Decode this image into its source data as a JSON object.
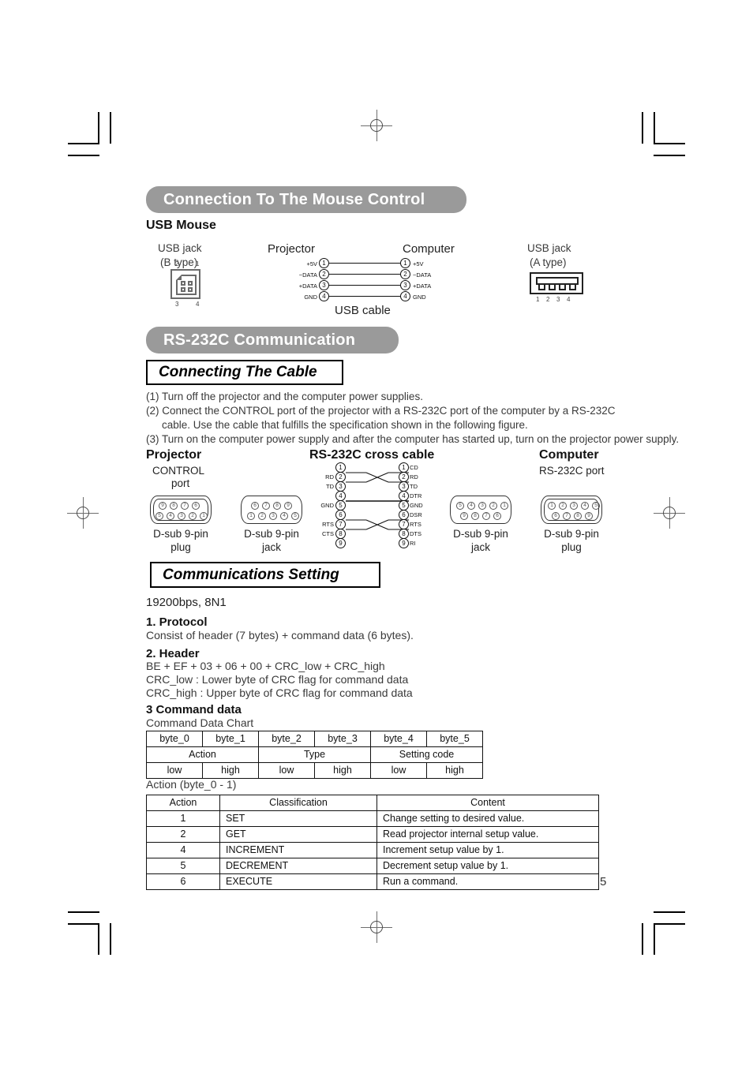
{
  "page": {
    "number": "5"
  },
  "sections": {
    "mouse_banner": "Connection To The Mouse Control",
    "rs232_banner": "RS-232C Communication",
    "connecting_cable_heading": "Connecting The Cable",
    "communications_setting_heading": "Communications Setting"
  },
  "usb": {
    "subheading": "USB Mouse",
    "jack_b": {
      "line1": "USB jack",
      "line2": "(B type)",
      "pins": [
        "2",
        "1",
        "3",
        "4"
      ]
    },
    "jack_a": {
      "line1": "USB jack",
      "line2": "(A type)",
      "pins": [
        "1",
        "2",
        "3",
        "4"
      ]
    },
    "left_device": "Projector",
    "right_device": "Computer",
    "cable_label": "USB cable",
    "pins": [
      {
        "num": "1",
        "left_signal": "+5V",
        "right_signal": "+5V"
      },
      {
        "num": "2",
        "left_signal": "−DATA",
        "right_signal": "−DATA"
      },
      {
        "num": "3",
        "left_signal": "+DATA",
        "right_signal": "+DATA"
      },
      {
        "num": "4",
        "left_signal": "GND",
        "right_signal": "GND"
      }
    ]
  },
  "connecting_steps": [
    "(1) Turn off the projector and the computer power supplies.",
    "(2) Connect the CONTROL port of the projector with a RS-232C port of the computer by a RS-232C",
    "cable. Use the cable that fulfills the specification shown in the following figure.",
    "(3) Turn on the computer power supply and after the computer has started up, turn on the projector power supply."
  ],
  "cable_diagram": {
    "left_title": "Projector",
    "left_sub_line1": "CONTROL",
    "left_sub_line2": "port",
    "center_title": "RS-232C cross cable",
    "right_title": "Computer",
    "right_sub": "RS-232C port",
    "connectors": [
      {
        "label_line1": "D-sub 9-pin",
        "label_line2": "plug",
        "type": "plug",
        "top_pins": [
          "9",
          "8",
          "7",
          "6"
        ],
        "bottom_pins": [
          "5",
          "4",
          "3",
          "2",
          "1"
        ]
      },
      {
        "label_line1": "D-sub 9-pin",
        "label_line2": "jack",
        "type": "jack",
        "top_pins": [
          "6",
          "7",
          "8",
          "9"
        ],
        "bottom_pins": [
          "1",
          "2",
          "3",
          "4",
          "5"
        ]
      },
      {
        "label_line1": "D-sub 9-pin",
        "label_line2": "jack",
        "type": "jack",
        "top_pins": [
          "5",
          "4",
          "3",
          "2",
          "1"
        ],
        "bottom_pins": [
          "9",
          "8",
          "7",
          "6"
        ]
      },
      {
        "label_line1": "D-sub 9-pin",
        "label_line2": "plug",
        "type": "plug",
        "top_pins": [
          "1",
          "2",
          "3",
          "4",
          "5"
        ],
        "bottom_pins": [
          "6",
          "7",
          "8",
          "9"
        ]
      }
    ],
    "pins": [
      {
        "num": "1",
        "left_signal": "",
        "right_signal": "CD"
      },
      {
        "num": "2",
        "left_signal": "RD",
        "right_signal": "RD"
      },
      {
        "num": "3",
        "left_signal": "TD",
        "right_signal": "TD"
      },
      {
        "num": "4",
        "left_signal": "",
        "right_signal": "DTR"
      },
      {
        "num": "5",
        "left_signal": "GND",
        "right_signal": "GND"
      },
      {
        "num": "6",
        "left_signal": "",
        "right_signal": "DSR"
      },
      {
        "num": "7",
        "left_signal": "RTS",
        "right_signal": "RTS"
      },
      {
        "num": "8",
        "left_signal": "CTS",
        "right_signal": "DTS"
      },
      {
        "num": "9",
        "left_signal": "",
        "right_signal": "RI"
      }
    ]
  },
  "comm": {
    "baud_line": "19200bps,  8N1",
    "protocol_heading": "1. Protocol",
    "protocol_text": "Consist of header (7 bytes) + command data (6 bytes).",
    "header_heading": "2. Header",
    "header_lines": [
      "BE + EF + 03 + 06 + 00 + CRC_low + CRC_high",
      "CRC_low : Lower byte of CRC flag for command data",
      "CRC_high : Upper byte of CRC flag for command data"
    ],
    "command_heading": "3 Command data",
    "command_chart_label": "Command Data Chart",
    "action_caption": "Action (byte_0 - 1)"
  },
  "command_chart": {
    "byte_row": [
      "byte_0",
      "byte_1",
      "byte_2",
      "byte_3",
      "byte_4",
      "byte_5"
    ],
    "group_row": [
      "Action",
      "Type",
      "Setting code"
    ],
    "lowhigh_row": [
      "low",
      "high",
      "low",
      "high",
      "low",
      "high"
    ]
  },
  "action_table": {
    "headers": [
      "Action",
      "Classification",
      "Content"
    ],
    "rows": [
      [
        "1",
        "SET",
        "Change setting to desired value."
      ],
      [
        "2",
        "GET",
        "Read projector internal setup value."
      ],
      [
        "4",
        "INCREMENT",
        "Increment setup value by 1."
      ],
      [
        "5",
        "DECREMENT",
        "Decrement setup value by 1."
      ],
      [
        "6",
        "EXECUTE",
        "Run a command."
      ]
    ]
  }
}
